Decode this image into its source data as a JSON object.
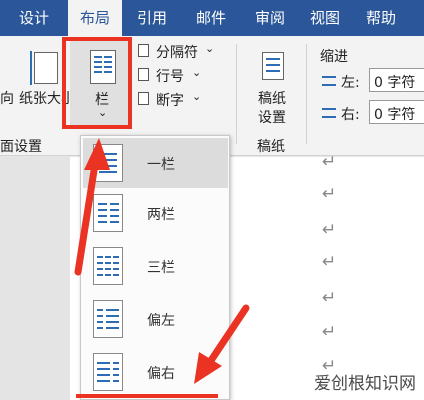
{
  "tabs": [
    "设计",
    "布局",
    "引用",
    "邮件",
    "审阅",
    "视图",
    "帮助"
  ],
  "ribbon": {
    "orientation_partial": "向",
    "paper_size": "纸张大小",
    "columns_label": "栏",
    "columns_chevron": "⌄",
    "breaks": "分隔符",
    "breaks_caret": "⌄",
    "line_numbers": "行号",
    "line_numbers_caret": "⌄",
    "hyphenation": "断字",
    "hyphenation_caret": "⌄",
    "manuscript_line1": "稿纸",
    "manuscript_line2": "设置",
    "group_page_setup": "面设置",
    "group_manuscript": "稿纸",
    "indent_title": "缩进",
    "left_label": "左:",
    "left_value": "0 字符",
    "right_label": "右:",
    "right_value": "0 字符"
  },
  "dropdown": {
    "items": [
      "一栏",
      "两栏",
      "三栏",
      "偏左",
      "偏右"
    ],
    "selected": "一栏"
  },
  "paragraph_mark": "↵",
  "watermark": "爱创根知识网",
  "colors": {
    "tab_bar": "#2b579a",
    "highlight": "#ea3323",
    "icon_blue": "#2e6db4"
  }
}
